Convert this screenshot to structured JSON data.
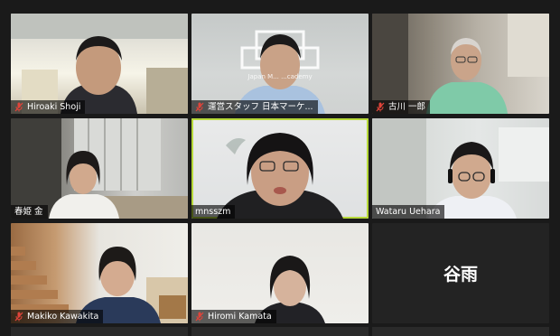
{
  "participants": [
    {
      "name": "Hiroaki Shoji",
      "muted": true
    },
    {
      "name": "運営スタッフ 日本マーケ...",
      "muted": true,
      "logo_text": "Japan M... ...cademy"
    },
    {
      "name": "古川 一郎",
      "muted": true
    },
    {
      "name": "春姫 金",
      "muted": false
    },
    {
      "name": "mnsszm",
      "muted": false,
      "active_speaker": true
    },
    {
      "name": "Wataru Uehara",
      "muted": false
    },
    {
      "name": "Makiko Kawakita",
      "muted": true
    },
    {
      "name": "Hiromi Kamata",
      "muted": true
    },
    {
      "placeholder_name": "谷雨",
      "video_off": true
    }
  ],
  "colors": {
    "background": "#1a1a1a",
    "active_border": "#b7d93a",
    "muted_icon": "#e0443a",
    "namebar": "rgba(0,0,0,0.62)"
  },
  "icons": {
    "muted": "microphone-muted-icon"
  }
}
